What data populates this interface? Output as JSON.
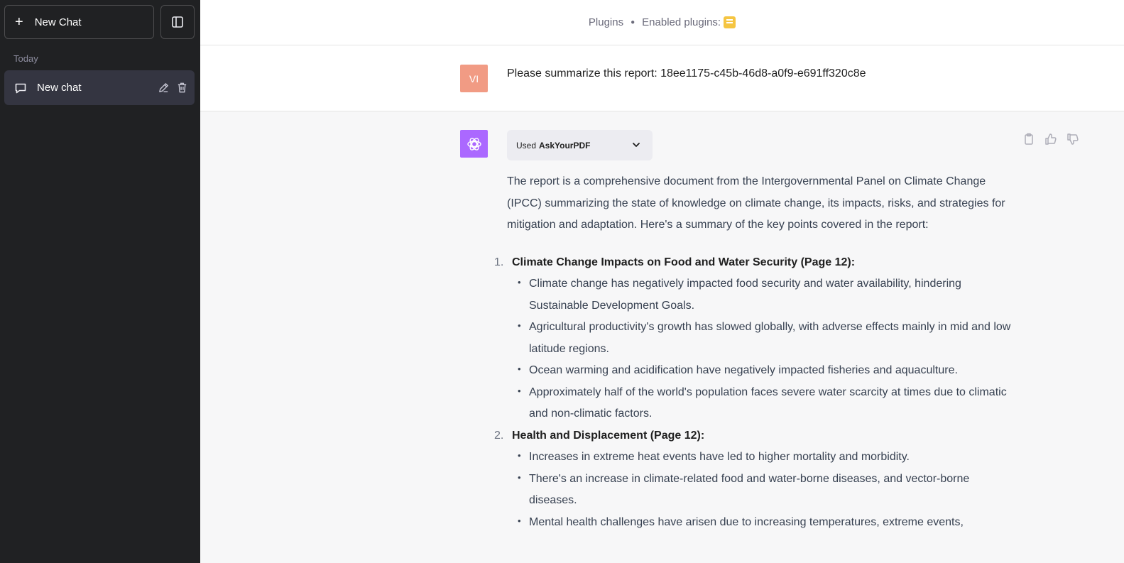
{
  "sidebar": {
    "new_chat_label": "New Chat",
    "section_label": "Today",
    "chat_items": [
      {
        "label": "New chat"
      }
    ]
  },
  "topbar": {
    "mode": "Plugins",
    "enabled_label": "Enabled plugins:"
  },
  "user_message": {
    "avatar_initials": "VI",
    "text": "Please summarize this report: 18ee1175-c45b-46d8-a0f9-e691ff320c8e"
  },
  "assistant_message": {
    "plugin_used_prefix": "Used",
    "plugin_name": "AskYourPDF",
    "intro": "The report is a comprehensive document from the Intergovernmental Panel on Climate Change (IPCC) summarizing the state of knowledge on climate change, its impacts, risks, and strategies for mitigation and adaptation. Here's a summary of the key points covered in the report:",
    "points": [
      {
        "num": "1.",
        "heading": "Climate Change Impacts on Food and Water Security (Page 12):",
        "bullets": [
          "Climate change has negatively impacted food security and water availability, hindering Sustainable Development Goals.",
          "Agricultural productivity's growth has slowed globally, with adverse effects mainly in mid and low latitude regions.",
          "Ocean warming and acidification have negatively impacted fisheries and aquaculture.",
          "Approximately half of the world's population faces severe water scarcity at times due to climatic and non-climatic factors."
        ]
      },
      {
        "num": "2.",
        "heading": "Health and Displacement (Page 12):",
        "bullets": [
          "Increases in extreme heat events have led to higher mortality and morbidity.",
          "There's an increase in climate-related food and water-borne diseases, and vector-borne diseases.",
          "Mental health challenges have arisen due to increasing temperatures, extreme events,"
        ]
      }
    ]
  },
  "colors": {
    "sidebar_bg": "#202123",
    "active_chat_bg": "#343541",
    "user_avatar": "#f19b84",
    "assistant_avatar": "#ab68ff",
    "assistant_row_bg": "#f7f7f8",
    "plugin_badge": "#f5c542"
  },
  "icons": {
    "new_chat": "plus-icon",
    "sidebar_toggle": "sidebar-toggle-icon",
    "chat": "message-icon",
    "edit": "pencil-icon",
    "delete": "trash-icon",
    "plugin": "askyourpdf-plugin-icon",
    "assistant": "openai-logo-icon",
    "expand": "chevron-down-icon",
    "copy": "clipboard-icon",
    "like": "thumbs-up-icon",
    "dislike": "thumbs-down-icon"
  }
}
